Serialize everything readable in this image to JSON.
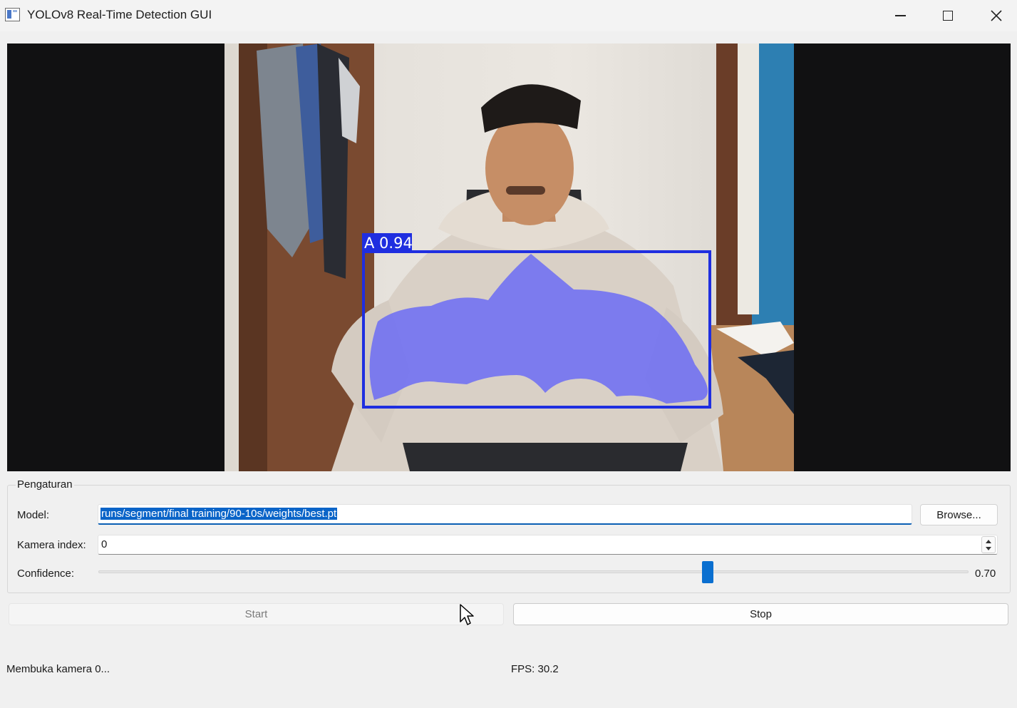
{
  "window": {
    "title": "YOLOv8 Real-Time Detection GUI"
  },
  "video": {
    "detection_label": "A 0.94",
    "detection_color": "#1f2ee0",
    "mask_color": "#6b6cf5"
  },
  "settings": {
    "group_title": "Pengaturan",
    "model_label": "Model:",
    "model_value": "runs/segment/final training/90-10s/weights/best.pt",
    "browse_label": "Browse...",
    "camera_label": "Kamera index:",
    "camera_value": "0",
    "confidence_label": "Confidence:",
    "confidence_value": "0.70",
    "confidence_fraction": 0.7
  },
  "controls": {
    "start_label": "Start",
    "stop_label": "Stop"
  },
  "status": {
    "message": "Membuka kamera 0...",
    "fps": "FPS: 30.2"
  },
  "colors": {
    "accent": "#0a6fd0",
    "background": "#f0f0f0"
  }
}
